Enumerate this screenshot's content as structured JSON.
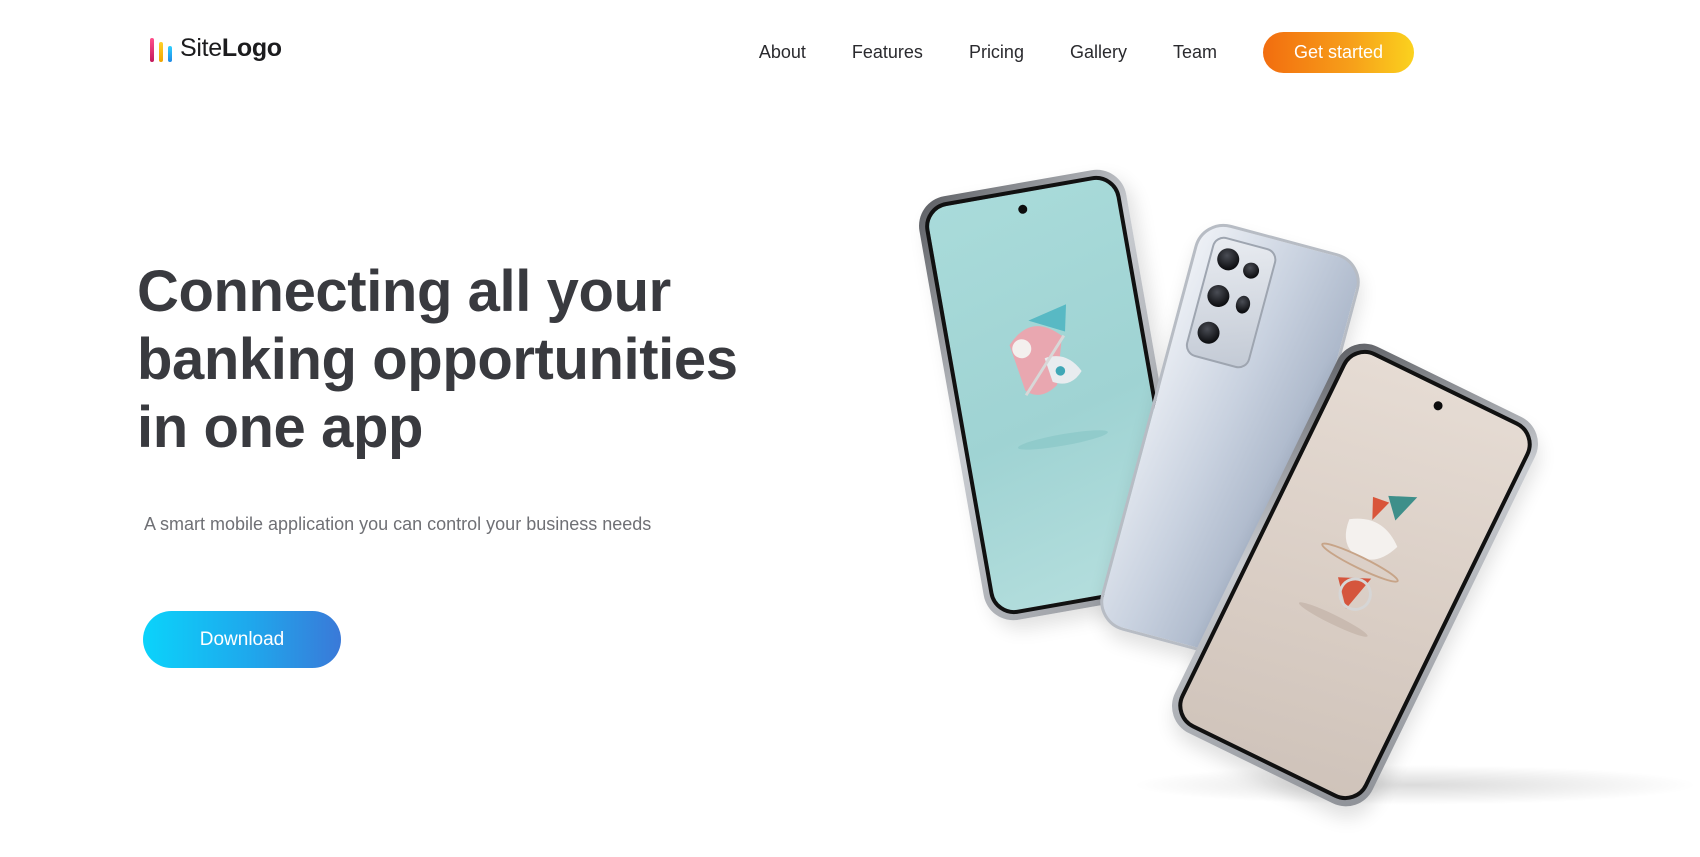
{
  "header": {
    "logo": {
      "light": "Site",
      "bold": "Logo"
    },
    "nav": [
      {
        "label": "About"
      },
      {
        "label": "Features"
      },
      {
        "label": "Pricing"
      },
      {
        "label": "Gallery"
      },
      {
        "label": "Team"
      }
    ],
    "cta_label": "Get started"
  },
  "hero": {
    "title_lines": [
      "Connecting all your",
      "banking opportunities",
      "in one app"
    ],
    "subtitle": "A smart mobile application you can control your business needs",
    "download_label": "Download"
  },
  "colors": {
    "cta_gradient": [
      "#f26d0f",
      "#fbd21e"
    ],
    "download_gradient": [
      "#0bd3fb",
      "#3a79d8"
    ],
    "heading": "#393a3f",
    "body_text": "#6f7075"
  },
  "icons": {
    "logo_mark": "three-colored-bars-icon",
    "phones_image": "three-smartphones-illustration"
  }
}
